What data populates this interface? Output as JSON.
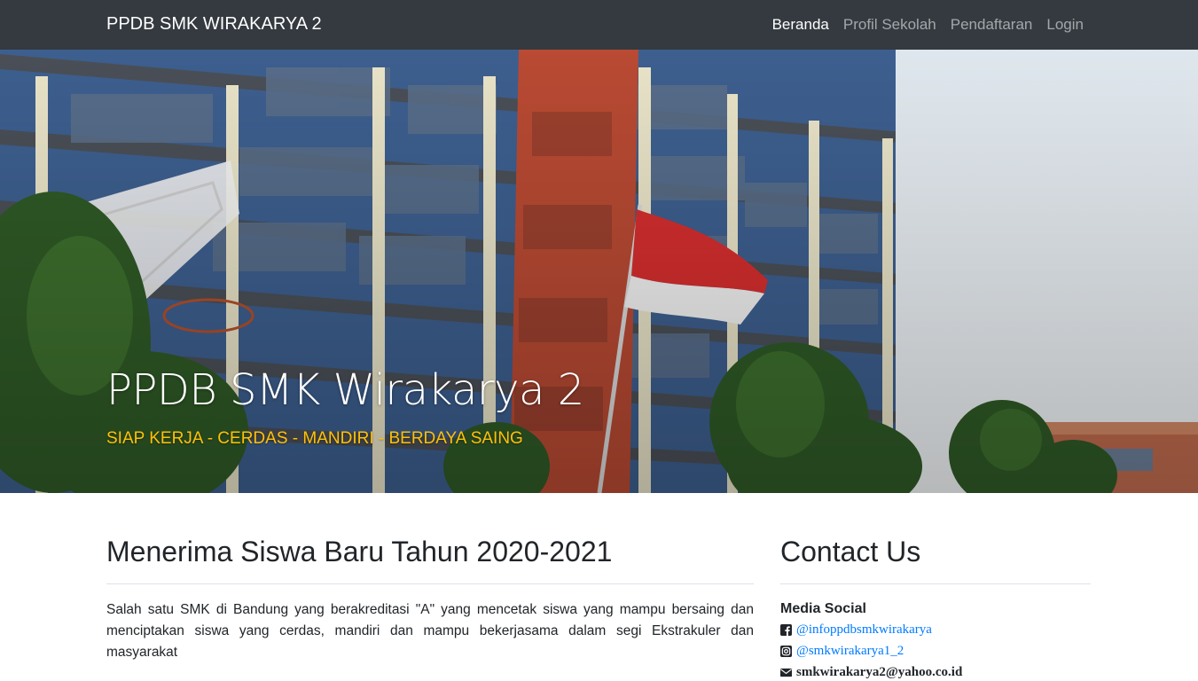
{
  "navbar": {
    "brand": "PPDB SMK WIRAKARYA 2",
    "items": [
      {
        "label": "Beranda",
        "active": true
      },
      {
        "label": "Profil Sekolah",
        "active": false
      },
      {
        "label": "Pendaftaran",
        "active": false
      },
      {
        "label": "Login",
        "active": false
      }
    ]
  },
  "hero": {
    "title": "PPDB SMK Wirakarya 2",
    "subtitle": "SIAP KERJA - CERDAS - MANDIRI - BERDAYA SAING"
  },
  "main": {
    "heading": "Menerima Siswa Baru Tahun 2020-2021",
    "text": "Salah satu SMK di Bandung yang berakreditasi \"A\" yang mencetak siswa yang mampu bersaing dan menciptakan siswa yang cerdas, mandiri dan mampu bekerjasama dalam segi Ekstrakuler dan masyarakat"
  },
  "sidebar": {
    "heading": "Contact Us",
    "media_label": "Media Social",
    "facebook": "@infoppdbsmkwirakarya",
    "instagram": "@smkwirakarya1_2",
    "email": "smkwirakarya2@yahoo.co.id"
  },
  "colors": {
    "navbar_bg": "#343a40",
    "accent_yellow": "#ffc107",
    "link_blue": "#007bff"
  }
}
